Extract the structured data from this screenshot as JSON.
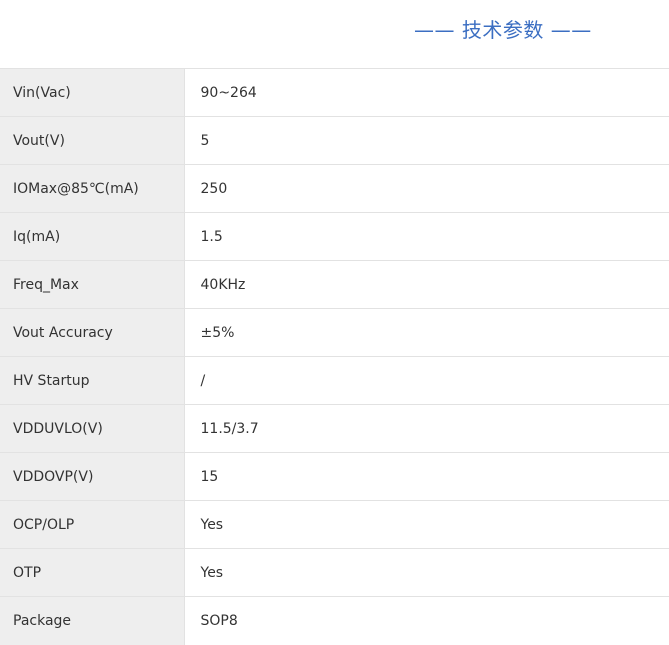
{
  "header": {
    "title": "—— 技术参数 ——"
  },
  "specs": {
    "rows": [
      {
        "param": "Vin(Vac)",
        "value": "90~264"
      },
      {
        "param": "Vout(V)",
        "value": "5"
      },
      {
        "param": "IOMax@85℃(mA)",
        "value": "250"
      },
      {
        "param": "Iq(mA)",
        "value": "1.5"
      },
      {
        "param": "Freq_Max",
        "value": "40KHz"
      },
      {
        "param": "Vout Accuracy",
        "value": "±5%"
      },
      {
        "param": "HV Startup",
        "value": "/"
      },
      {
        "param": "VDDUVLO(V)",
        "value": "11.5/3.7"
      },
      {
        "param": "VDDOVP(V)",
        "value": "15"
      },
      {
        "param": "OCP/OLP",
        "value": "Yes"
      },
      {
        "param": "OTP",
        "value": "Yes"
      },
      {
        "param": "Package",
        "value": "SOP8"
      }
    ]
  }
}
